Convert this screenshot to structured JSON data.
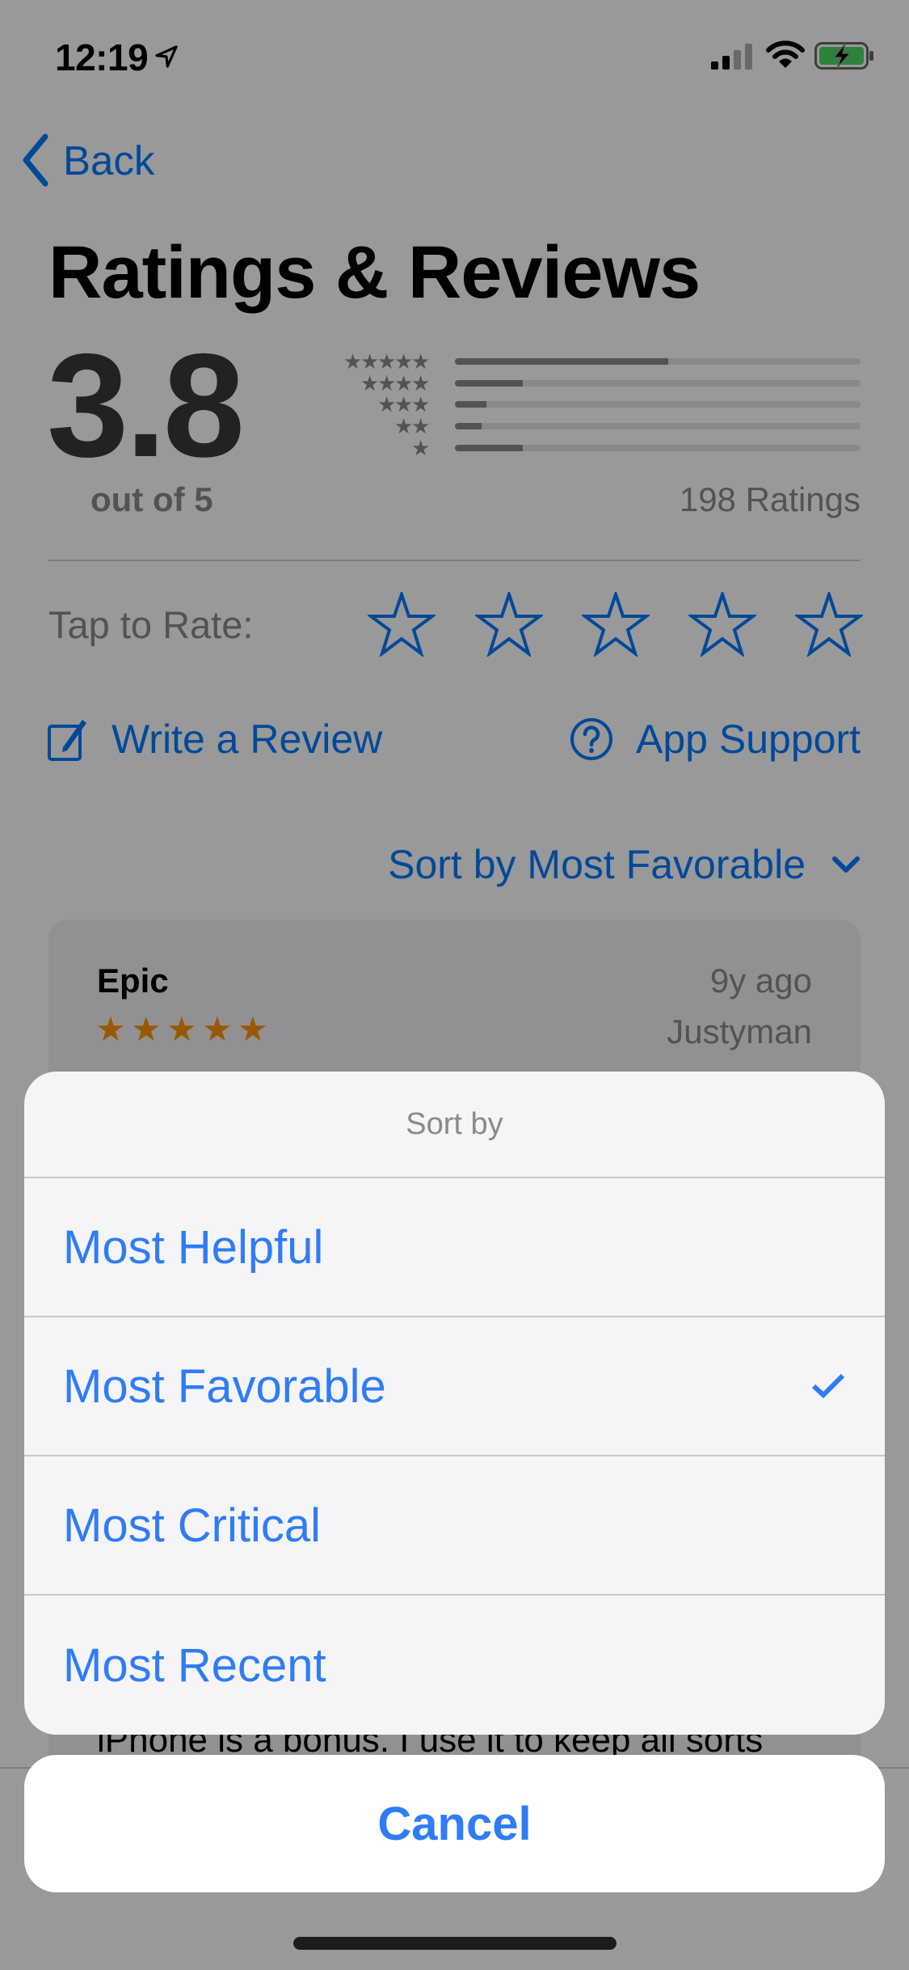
{
  "status_bar": {
    "time": "12:19",
    "icons": [
      "location-arrow-icon",
      "cellular-signal-icon",
      "wifi-icon",
      "battery-charging-icon"
    ],
    "signal_bars_active": 2,
    "signal_bars_total": 4,
    "battery_color": "#4cd964"
  },
  "nav": {
    "back_label": "Back"
  },
  "page": {
    "title": "Ratings & Reviews",
    "average": "3.8",
    "out_of": "out of 5",
    "ratings_count": "198 Ratings",
    "histogram": [
      {
        "stars": 5,
        "fraction": 0.525
      },
      {
        "stars": 4,
        "fraction": 0.167
      },
      {
        "stars": 3,
        "fraction": 0.077
      },
      {
        "stars": 2,
        "fraction": 0.065
      },
      {
        "stars": 1,
        "fraction": 0.167
      }
    ],
    "tap_to_rate": "Tap to Rate:",
    "rate_stars": 5,
    "write_review": "Write a Review",
    "app_support": "App Support",
    "sort_label": "Sort by Most Favorable",
    "accent_color": "#007aff"
  },
  "review": {
    "title": "Epic",
    "date": "9y ago",
    "author": "Justyman",
    "rating": 5,
    "body_visible": "iPhone is a bonus.  I use it to keep all sorts",
    "star_color": "#ff9500"
  },
  "action_sheet": {
    "header": "Sort by",
    "options": [
      {
        "label": "Most Helpful",
        "selected": false
      },
      {
        "label": "Most Favorable",
        "selected": true
      },
      {
        "label": "Most Critical",
        "selected": false
      },
      {
        "label": "Most Recent",
        "selected": false
      }
    ],
    "cancel_label": "Cancel",
    "option_color": "#2f7cf6"
  }
}
